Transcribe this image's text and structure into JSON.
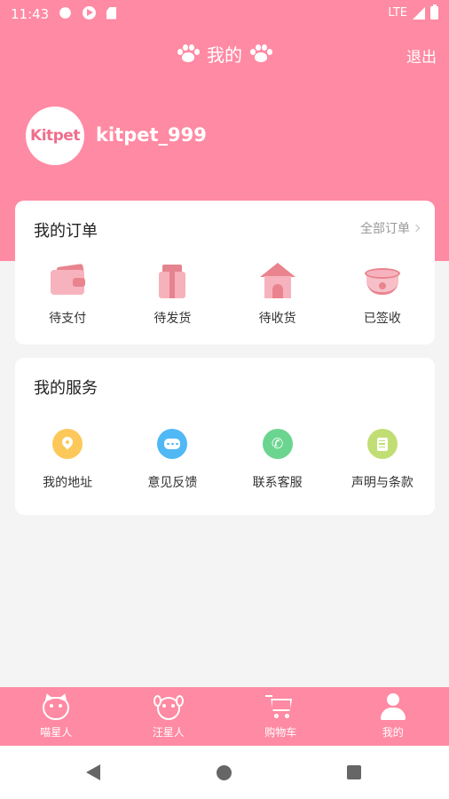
{
  "status_bar": {
    "time": "11:43",
    "network": "LTE"
  },
  "header": {
    "title": "我的",
    "logout": "退出"
  },
  "profile": {
    "avatar_text": "Kitpet",
    "username": "kitpet_999"
  },
  "orders": {
    "title": "我的订单",
    "all_link": "全部订单",
    "items": [
      {
        "label": "待支付",
        "icon": "wallet-icon"
      },
      {
        "label": "待发货",
        "icon": "package-icon"
      },
      {
        "label": "待收货",
        "icon": "pet-house-icon"
      },
      {
        "label": "已签收",
        "icon": "pet-bowl-icon"
      }
    ]
  },
  "services": {
    "title": "我的服务",
    "items": [
      {
        "label": "我的地址",
        "icon": "location-icon",
        "color": "#fdc85a"
      },
      {
        "label": "意见反馈",
        "icon": "chat-bubble-icon",
        "color": "#4fb8f5"
      },
      {
        "label": "联系客服",
        "icon": "phone-icon",
        "color": "#6bd58f"
      },
      {
        "label": "声明与条款",
        "icon": "document-icon",
        "color": "#c1de75"
      }
    ]
  },
  "bottom_nav": [
    {
      "label": "喵星人",
      "icon": "cat-icon"
    },
    {
      "label": "汪星人",
      "icon": "dog-icon"
    },
    {
      "label": "购物车",
      "icon": "cart-icon"
    },
    {
      "label": "我的",
      "icon": "person-icon",
      "active": true
    }
  ],
  "colors": {
    "brand_pink": "#ff8aa3",
    "background": "#f4f4f4",
    "card": "#ffffff"
  }
}
